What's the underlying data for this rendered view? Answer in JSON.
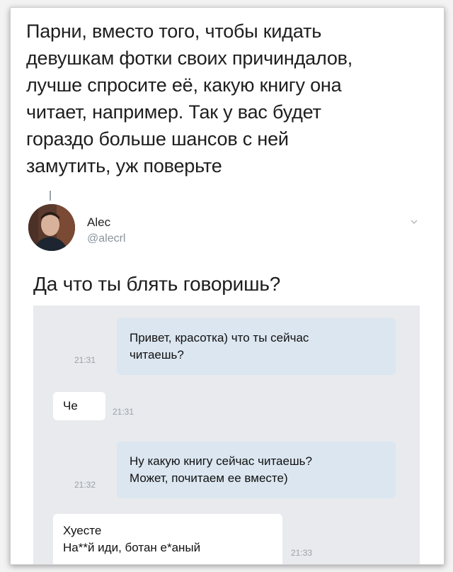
{
  "tweet": {
    "text": "Парни, вместо того, чтобы кидать\nдевушкам фотки своих причиндалов,\nлучше спросите её, какую книгу она\nчитает, например. Так у вас будет\nгораздо больше шансов с ней\nзамутить, уж поверьте"
  },
  "reply": {
    "author_name": "Alec",
    "author_handle": "@alecrl",
    "text": "Да что ты блять говоришь?"
  },
  "chat": {
    "messages": [
      {
        "direction": "out",
        "text": "Привет, красотка) что ты сейчас\nчитаешь?",
        "time": "21:31"
      },
      {
        "direction": "in",
        "text": "Че",
        "time": "21:31"
      },
      {
        "direction": "out",
        "text": "Ну какую книгу сейчас читаешь?\nМожет, почитаем ее вместе)",
        "time": "21:32"
      },
      {
        "direction": "in",
        "text": "Хуесте\nНа**й иди, ботан е*аный",
        "time": "21:33"
      }
    ]
  },
  "icons": {
    "avatar": "user-photo",
    "chevron": "chevron-down-icon"
  }
}
